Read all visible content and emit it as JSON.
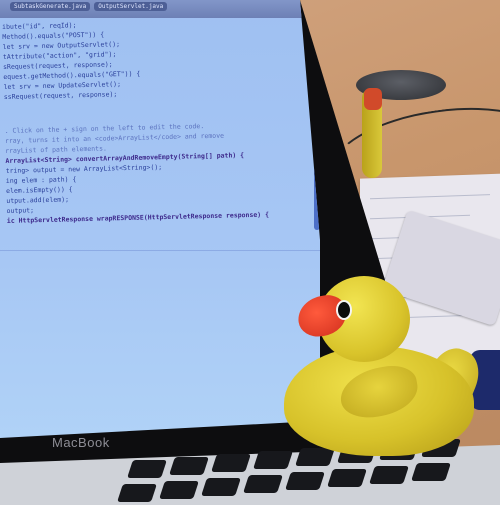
{
  "scene": {
    "description": "Laptop showing code editor with a rubber duck on desk",
    "laptop_brand": "MacBook"
  },
  "editor": {
    "tabs": [
      "SubtaskGenerate.java",
      "OutputServlet.java"
    ],
    "code_lines": [
      "ibute(\"id\", reqId);",
      "Method().equals(\"POST\")) {",
      "let srv = new OutputServlet();",
      "tAttribute(\"action\", \"grid\");",
      "sRequest(request, response);",
      "equest.getMethod().equals(\"GET\")) {",
      "let srv = new UpdateServlet();",
      "ssRequest(request, response);"
    ],
    "comment_lines": [
      ". Click on the + sign on the left to edit the code.",
      "",
      "rray, turns it into an <code>ArrayList</code> and remove",
      "",
      "",
      "rrayList of path elements."
    ],
    "method_lines": [
      "ArrayList<String> convertArrayAndRemoveEmpty(String[] path) {",
      "tring> output = new ArrayList<String>();",
      "ing elem : path) {",
      "elem.isEmpty()) {",
      "utput.add(elem);",
      "",
      "",
      "output;",
      "",
      "",
      "ic HttpServletResponse wrapRESPONSE(HttpServletResponse response) {"
    ]
  },
  "colors": {
    "duck": "#e3d032",
    "beak": "#ff4a2a",
    "screen": "#a6c6f3",
    "desk": "#c99a72"
  }
}
